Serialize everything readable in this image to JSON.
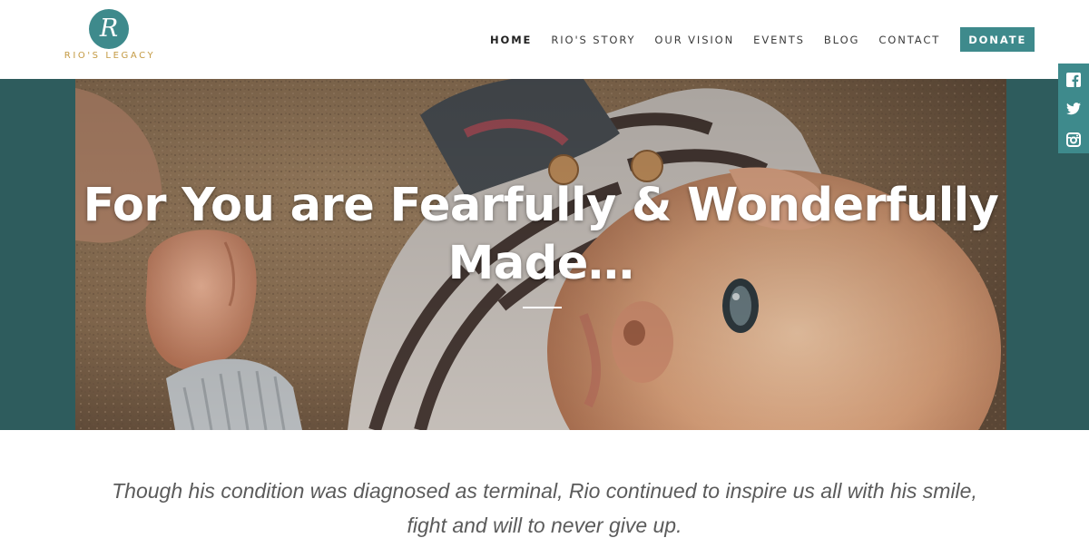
{
  "logo": {
    "monogram": "R",
    "name": "RIO'S LEGACY"
  },
  "nav": {
    "items": [
      {
        "label": "HOME",
        "active": true
      },
      {
        "label": "RIO'S STORY",
        "active": false
      },
      {
        "label": "OUR VISION",
        "active": false
      },
      {
        "label": "EVENTS",
        "active": false
      },
      {
        "label": "BLOG",
        "active": false
      },
      {
        "label": "CONTACT",
        "active": false
      }
    ],
    "donate_label": "DONATE"
  },
  "hero": {
    "title_line1": "For You are Fearfully & Wonderfully",
    "title_line2": "Made…",
    "image_subject": "baby lying on sand"
  },
  "social": {
    "icons": [
      "facebook-icon",
      "twitter-icon",
      "instagram-icon"
    ]
  },
  "intro": {
    "line1": "Though his condition was diagnosed as terminal, Rio continued to inspire us all with his smile,",
    "line2": "fight and will to never give up."
  },
  "colors": {
    "accent": "#3e8a8c",
    "hero_band": "#2e5c5d",
    "logo_text": "#c49a43",
    "body_text": "#5b5b5b"
  }
}
